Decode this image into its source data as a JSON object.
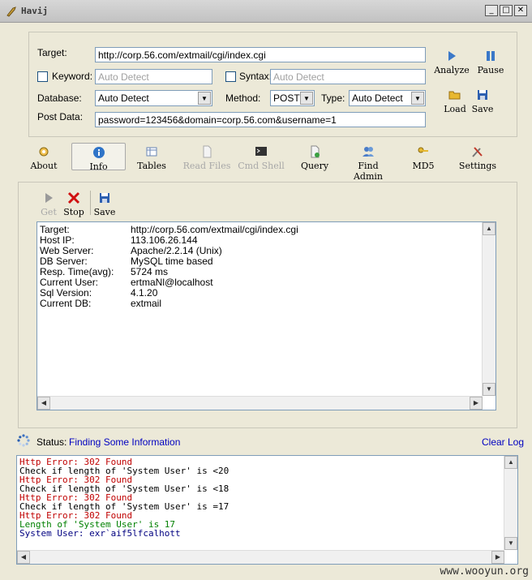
{
  "window": {
    "title": "Havij"
  },
  "form": {
    "target_label": "Target:",
    "target_value": "http://corp.56.com/extmail/cgi/index.cgi",
    "keyword_label": "Keyword:",
    "keyword_placeholder": "Auto Detect",
    "syntax_label": "Syntax:",
    "syntax_placeholder": "Auto Detect",
    "database_label": "Database:",
    "database_value": "Auto Detect",
    "method_label": "Method:",
    "method_value": "POST",
    "type_label": "Type:",
    "type_value": "Auto Detect",
    "postdata_label": "Post Data:",
    "postdata_value": "password=123456&domain=corp.56.com&username=1"
  },
  "actions": {
    "analyze": "Analyze",
    "pause": "Pause",
    "load": "Load",
    "save": "Save"
  },
  "tabs": [
    {
      "label": "About"
    },
    {
      "label": "Info"
    },
    {
      "label": "Tables"
    },
    {
      "label": "Read Files"
    },
    {
      "label": "Cmd Shell"
    },
    {
      "label": "Query"
    },
    {
      "label": "Find Admin"
    },
    {
      "label": "MD5"
    },
    {
      "label": "Settings"
    }
  ],
  "info_toolbar": {
    "get": "Get",
    "stop": "Stop",
    "save": "Save"
  },
  "info": [
    {
      "key": "Target:",
      "value": "http://corp.56.com/extmail/cgi/index.cgi"
    },
    {
      "key": "Host IP:",
      "value": "113.106.26.144"
    },
    {
      "key": "Web Server:",
      "value": "Apache/2.2.14 (Unix)"
    },
    {
      "key": "DB Server:",
      "value": "MySQL time based"
    },
    {
      "key": "Resp. Time(avg):",
      "value": "5724 ms"
    },
    {
      "key": "Current User:",
      "value": "ertmaNl@localhost"
    },
    {
      "key": "Sql Version:",
      "value": "4.1.20"
    },
    {
      "key": "Current DB:",
      "value": "extmail"
    }
  ],
  "status": {
    "label": "Status:",
    "value": "Finding Some Information",
    "clear_log": "Clear Log"
  },
  "log": [
    {
      "text": "Http Error: 302 Found",
      "color": "#c00000"
    },
    {
      "text": "Check if length of 'System User' is <20",
      "color": "#000000"
    },
    {
      "text": "Http Error: 302 Found",
      "color": "#c00000"
    },
    {
      "text": "Check if length of 'System User' is <18",
      "color": "#000000"
    },
    {
      "text": "Http Error: 302 Found",
      "color": "#c00000"
    },
    {
      "text": "Check if length of 'System User' is =17",
      "color": "#000000"
    },
    {
      "text": "Http Error: 302 Found",
      "color": "#c00000"
    },
    {
      "text": "Length of 'System User' is 17",
      "color": "#008000"
    },
    {
      "text": "System User: exr`aif5lfcalhott",
      "color": "#000080"
    }
  ],
  "watermark": "www.wooyun.org",
  "colors": {
    "link_blue": "#0000c0",
    "error_red": "#c00000",
    "ok_green": "#008000"
  }
}
